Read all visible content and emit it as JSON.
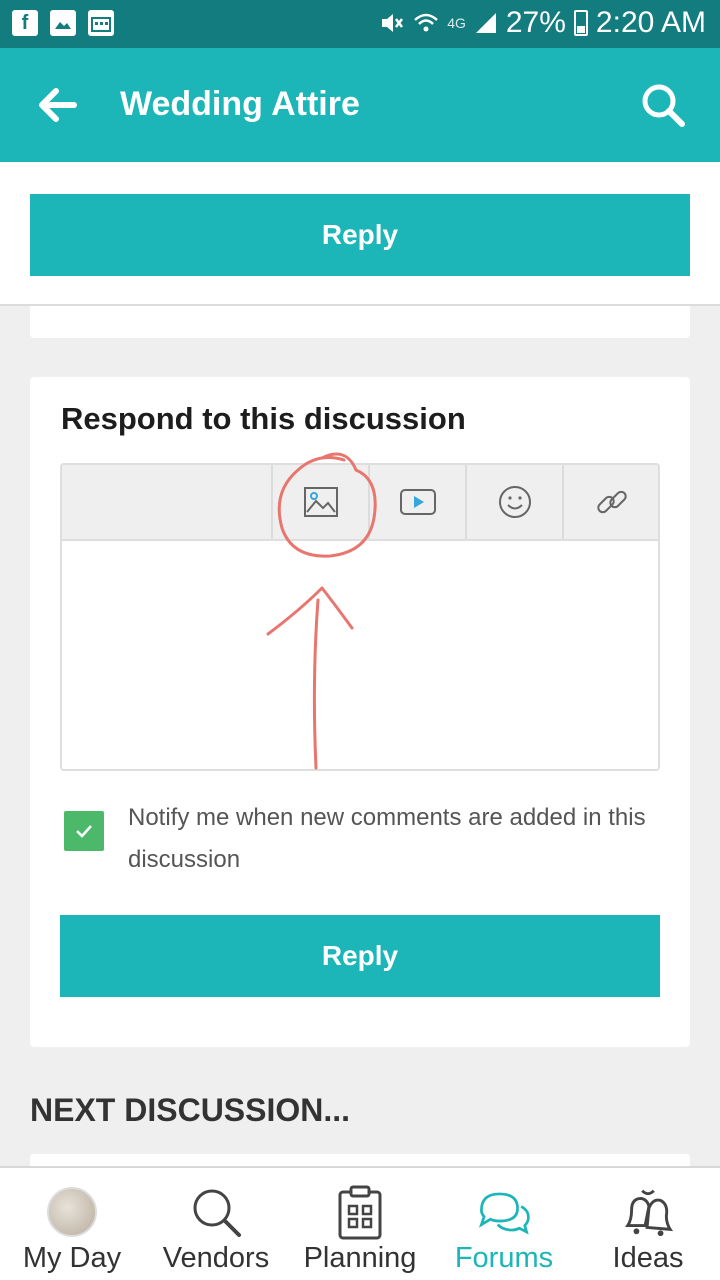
{
  "status_bar": {
    "network": "4G",
    "battery": "27%",
    "time": "2:20 AM"
  },
  "app_bar": {
    "title": "Wedding Attire"
  },
  "top_reply": {
    "label": "Reply"
  },
  "respond": {
    "heading": "Respond to this discussion",
    "toolbar": [
      "image-icon",
      "video-icon",
      "emoji-icon",
      "link-icon"
    ],
    "notify": {
      "checked": true,
      "label": "Notify me when new comments are added in this discussion"
    },
    "reply_label": "Reply"
  },
  "next_discussion": {
    "heading": "NEXT DISCUSSION..."
  },
  "bottom_nav": {
    "items": [
      {
        "label": "My Day",
        "icon": "avatar"
      },
      {
        "label": "Vendors",
        "icon": "search-icon"
      },
      {
        "label": "Planning",
        "icon": "clipboard-icon"
      },
      {
        "label": "Forums",
        "icon": "chat-bubbles-icon",
        "active": true
      },
      {
        "label": "Ideas",
        "icon": "bells-icon"
      }
    ]
  },
  "colors": {
    "primary": "#1cb5b8",
    "status_bar": "#127c7e",
    "checkbox": "#4cb86a",
    "annotation": "#e8766e"
  }
}
